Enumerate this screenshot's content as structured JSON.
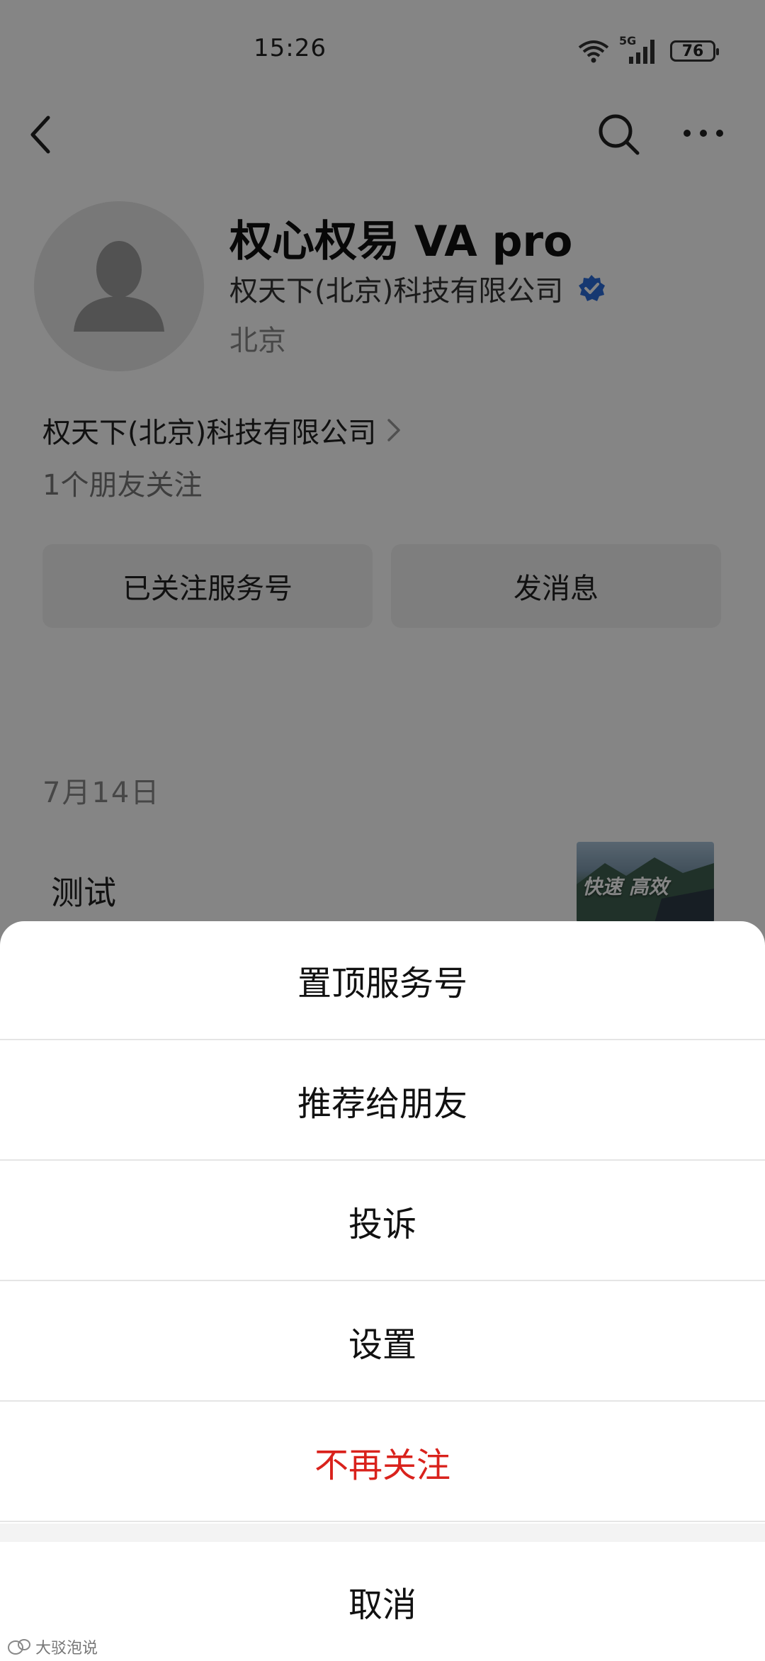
{
  "status": {
    "time": "15:26",
    "network": "5G",
    "battery": "76"
  },
  "nav": {
    "back_icon": "back-arrow-icon",
    "search_icon": "search-icon",
    "more_icon": "more-dots-icon"
  },
  "profile": {
    "name": "权心权易 VA pro",
    "company": "权天下(北京)科技有限公司",
    "location": "北京",
    "verified_color": "#2b6cd8"
  },
  "company_link": {
    "label": "权天下(北京)科技有限公司"
  },
  "friends_following": "1个朋友关注",
  "buttons": {
    "followed": "已关注服务号",
    "message": "发消息"
  },
  "message": {
    "date": "7月14日",
    "title": "测试",
    "thumb_text": "快速 高效"
  },
  "sheet": {
    "items": [
      "置顶服务号",
      "推荐给朋友",
      "投诉",
      "设置",
      "不再关注"
    ],
    "danger_color": "#d9221c",
    "cancel": "取消"
  },
  "watermark": "大驳泡说"
}
